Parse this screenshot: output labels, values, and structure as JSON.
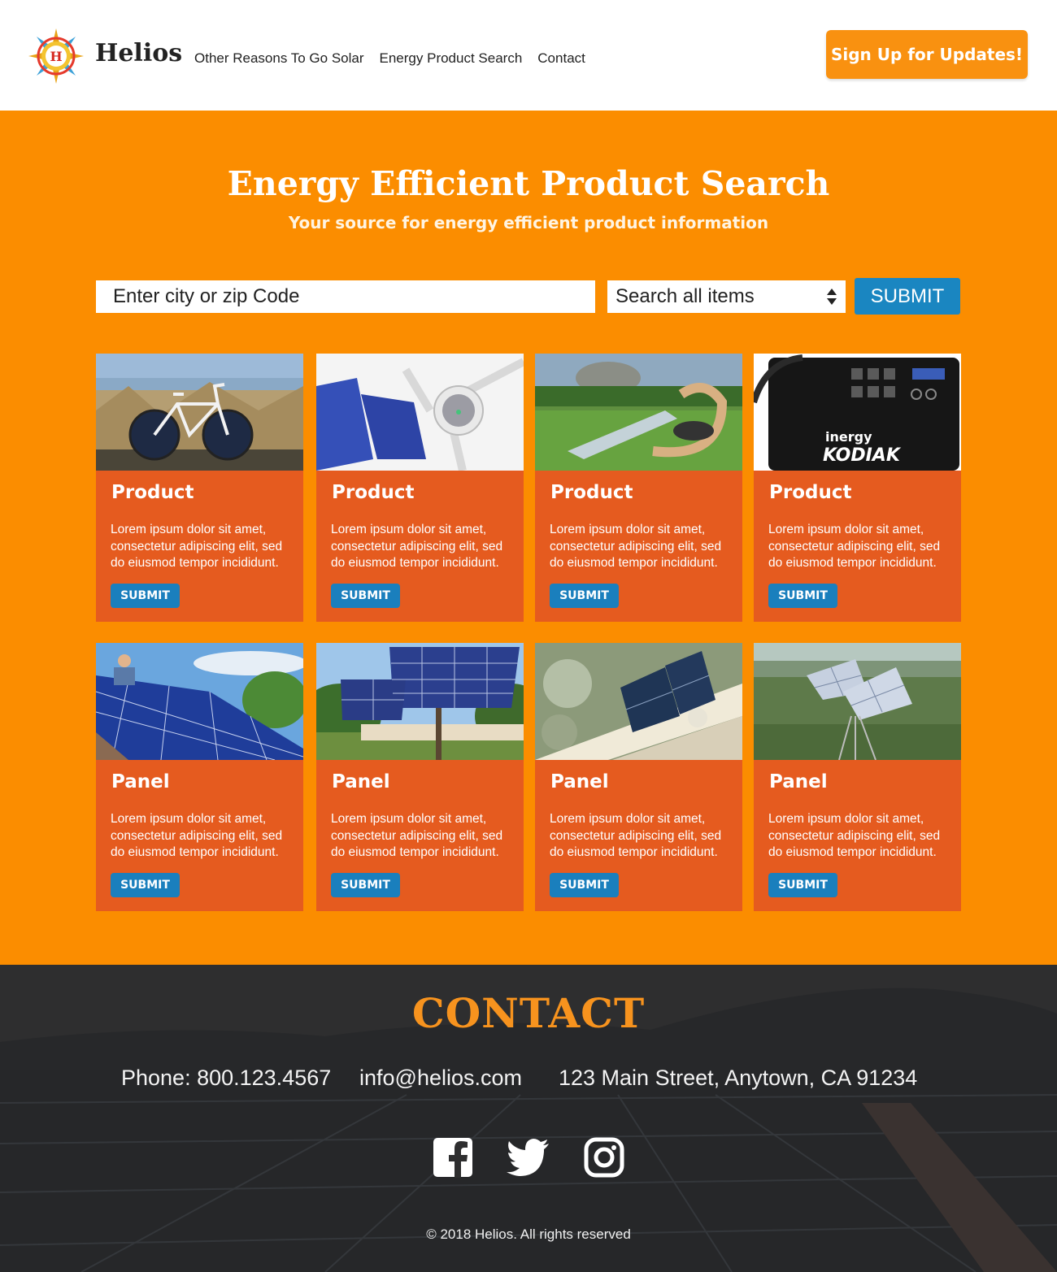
{
  "header": {
    "brand": "Helios",
    "logo_letter": "H",
    "nav": [
      "Other Reasons To Go Solar",
      "Energy Product Search",
      "Contact"
    ],
    "signup_label": "Sign Up for Updates!"
  },
  "hero": {
    "title": "Energy Efficient Product Search",
    "subtitle": "Your source for energy efficient product information",
    "search_placeholder": "Enter city or zip Code",
    "select_value": "Search all items",
    "submit_label": "SUBMIT"
  },
  "cards": [
    {
      "title": "Product",
      "text": "Lorem ipsum dolor sit amet, consectetur adipiscing elit, sed do eiusmod tempor incididunt.",
      "button": "SUBMIT",
      "image": "solar-bicycle"
    },
    {
      "title": "Product",
      "text": "Lorem ipsum dolor sit amet, consectetur adipiscing elit, sed do eiusmod tempor incididunt.",
      "button": "SUBMIT",
      "image": "solar-fan"
    },
    {
      "title": "Product",
      "text": "Lorem ipsum dolor sit amet, consectetur adipiscing elit, sed do eiusmod tempor incididunt.",
      "button": "SUBMIT",
      "image": "solar-bench"
    },
    {
      "title": "Product",
      "text": "Lorem ipsum dolor sit amet, consectetur adipiscing elit, sed do eiusmod tempor incididunt.",
      "button": "SUBMIT",
      "image": "power-station",
      "image_text": [
        "inergy",
        "KODIAK"
      ]
    },
    {
      "title": "Panel",
      "text": "Lorem ipsum dolor sit amet, consectetur adipiscing elit, sed do eiusmod tempor incididunt.",
      "button": "SUBMIT",
      "image": "roof-panels"
    },
    {
      "title": "Panel",
      "text": "Lorem ipsum dolor sit amet, consectetur adipiscing elit, sed do eiusmod tempor incididunt.",
      "button": "SUBMIT",
      "image": "pole-panel"
    },
    {
      "title": "Panel",
      "text": "Lorem ipsum dolor sit amet, consectetur adipiscing elit, sed do eiusmod tempor incididunt.",
      "button": "SUBMIT",
      "image": "wall-panel"
    },
    {
      "title": "Panel",
      "text": "Lorem ipsum dolor sit amet, consectetur adipiscing elit, sed do eiusmod tempor incididunt.",
      "button": "SUBMIT",
      "image": "field-panels"
    }
  ],
  "contact": {
    "title": "CONTACT",
    "phone": "Phone: 800.123.4567",
    "email": "info@helios.com",
    "address": "123 Main Street, Anytown, CA 91234",
    "social": [
      "facebook-icon",
      "twitter-icon",
      "instagram-icon"
    ],
    "copyright": "© 2018 Helios. All rights reserved"
  },
  "colors": {
    "orange": "#fb8d00",
    "card": "#e55b1f",
    "blue": "#1a86c1",
    "contact_title": "#f7931e"
  }
}
